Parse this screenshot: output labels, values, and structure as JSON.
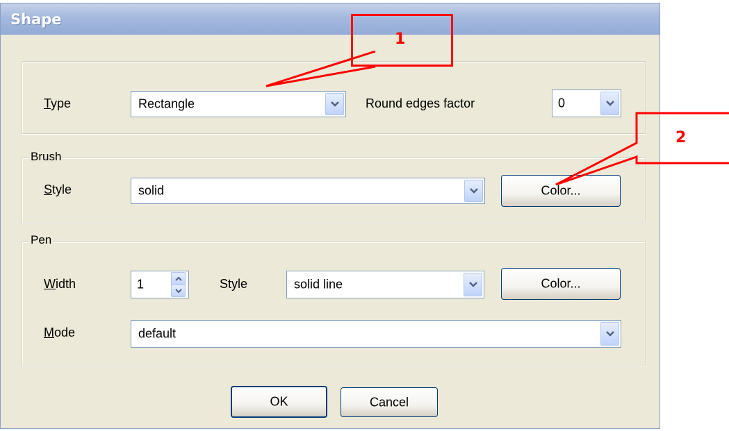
{
  "window": {
    "title": "Shape"
  },
  "type_row": {
    "label_prefix": "T",
    "label_rest": "ype",
    "value": "Rectangle",
    "round_label": "Round edges factor",
    "round_value": "0"
  },
  "brush": {
    "legend": "Brush",
    "style_prefix": "S",
    "style_rest": "tyle",
    "style_value": "solid",
    "color_button": "Color..."
  },
  "pen": {
    "legend": "Pen",
    "width_prefix": "W",
    "width_rest": "idth",
    "width_value": "1",
    "style_label": "Style",
    "style_value": "solid line",
    "color_button": "Color...",
    "mode_prefix": "M",
    "mode_rest": "ode",
    "mode_value": "default"
  },
  "buttons": {
    "ok": "OK",
    "cancel": "Cancel"
  },
  "annotations": {
    "callout1": "1",
    "callout2": "2"
  },
  "colors": {
    "annotation": "#ff0000",
    "dialog_bg": "#ece9d8",
    "title_bar": "#a5b9de"
  }
}
